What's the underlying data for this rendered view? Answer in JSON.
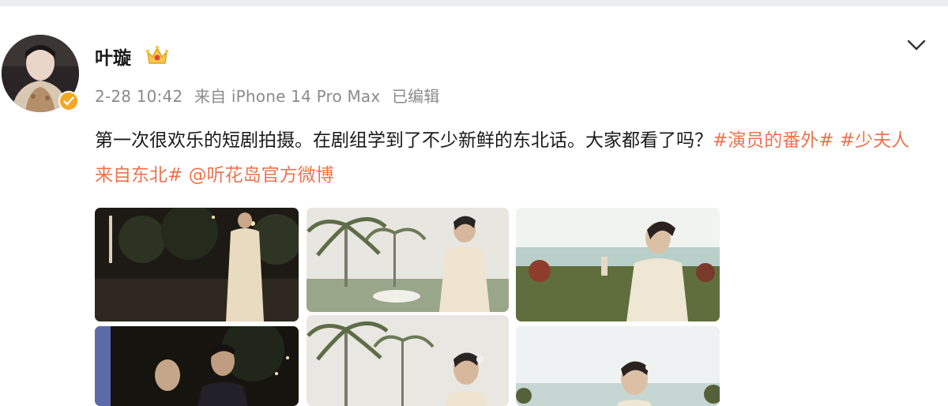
{
  "header": {
    "username": "叶璇",
    "crown_icon": "crown-icon",
    "verified_icon": "verified-badge-icon",
    "menu_icon": "chevron-down-icon"
  },
  "meta": {
    "time": "2-28 10:42",
    "source": "来自 iPhone 14 Pro Max",
    "edited": "已编辑"
  },
  "post": {
    "text": "第一次很欢乐的短剧拍摄。在剧组学到了不少新鲜的东北话。大家都看了吗？",
    "links": [
      "#演员的番外#",
      "#少夫人来自东北#",
      "@听花岛官方微博"
    ]
  },
  "photos": [
    {
      "name": "photo-night-garden",
      "scene": "night"
    },
    {
      "name": "photo-palm-trees",
      "scene": "palms"
    },
    {
      "name": "photo-sea-view",
      "scene": "sea"
    },
    {
      "name": "photo-night-couple",
      "scene": "night-couple"
    },
    {
      "name": "photo-palm-portrait",
      "scene": "palms"
    },
    {
      "name": "photo-sea-portrait",
      "scene": "sea"
    }
  ],
  "colors": {
    "link": "#eb7350",
    "meta": "#8b8b8b",
    "verified": "#f6a623"
  }
}
